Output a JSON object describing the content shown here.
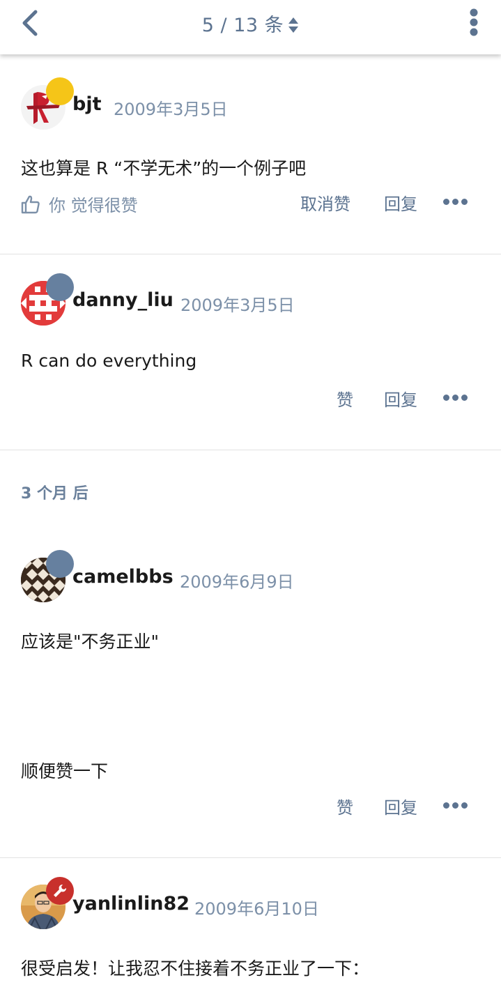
{
  "header": {
    "position_label": "5 / 13 条"
  },
  "posts": [
    {
      "username": "bjt",
      "date": "2009年3月5日",
      "content": [
        "这也算是 R “不学无术”的一个例子吧"
      ],
      "liked_text": "你 觉得很赞",
      "like_label": "取消赞",
      "reply_label": "回复"
    },
    {
      "username": "danny_liu",
      "date": "2009年3月5日",
      "content": [
        "R can do everything"
      ],
      "like_label": "赞",
      "reply_label": "回复"
    },
    {
      "username": "camelbbs",
      "date": "2009年6月9日",
      "content": [
        "应该是\"不务正业\"",
        "顺便赞一下"
      ],
      "like_label": "赞",
      "reply_label": "回复"
    },
    {
      "username": "yanlinlin82",
      "date": "2009年6月10日",
      "content": [
        "很受启发！让我忍不住接着不务正业了一下："
      ]
    }
  ],
  "time_gap": "3 个月 后",
  "icons": {
    "back": "chevron-left-icon",
    "sort": "sort-icon",
    "menu": "more-vertical-icon",
    "like": "thumbs-up-icon",
    "more": "more-horizontal-icon",
    "moderator": "wrench-icon"
  },
  "colors": {
    "accent": "#5c7390",
    "muted": "#7c90a8",
    "badge_blue": "#66809f",
    "badge_yellow": "#f5c518",
    "badge_red": "#c8302c"
  }
}
